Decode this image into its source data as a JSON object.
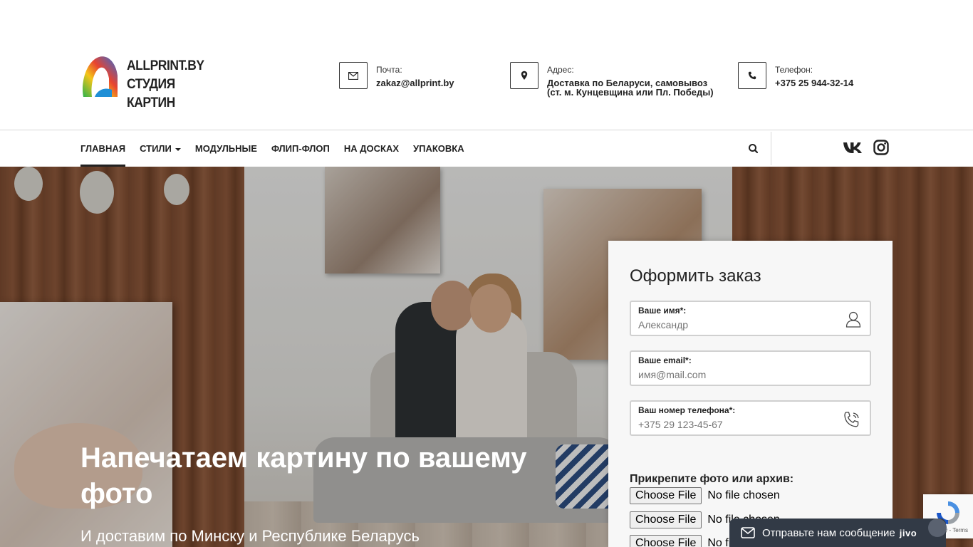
{
  "header": {
    "logo_line1": "ALLPRINT.BY",
    "logo_line2": "СТУДИЯ КАРТИН",
    "contacts": [
      {
        "icon": "envelope-icon",
        "label": "Почта:",
        "value": "zakaz@allprint.by"
      },
      {
        "icon": "map-marker-icon",
        "label": "Адрес:",
        "value_line1": "Доставка по Беларуси, самовывоз",
        "value_line2": "(ст. м. Кунцевщина или Пл. Победы)"
      },
      {
        "icon": "phone-icon",
        "label": "Телефон:",
        "value": "+375 25 944-32-14"
      }
    ]
  },
  "nav": {
    "items": [
      {
        "label": "ГЛАВНАЯ",
        "active": true
      },
      {
        "label": "СТИЛИ",
        "dropdown": true
      },
      {
        "label": "МОДУЛЬНЫЕ"
      },
      {
        "label": "ФЛИП-ФЛОП"
      },
      {
        "label": "НА ДОСКАХ"
      },
      {
        "label": "УПАКОВКА"
      }
    ],
    "social": [
      "vk-icon",
      "instagram-icon"
    ]
  },
  "hero": {
    "title": "Напечатаем картину по вашему фото",
    "subtitle": "И доставим по Минску и Республике Беларусь"
  },
  "order_form": {
    "title": "Оформить заказ",
    "name": {
      "label": "Ваше имя*:",
      "placeholder": "Александр"
    },
    "email": {
      "label": "Ваше email*:",
      "placeholder": "имя@mail.com"
    },
    "phone": {
      "label": "Ваш номер телефона*:",
      "placeholder": "+375 29 123-45-67"
    },
    "attach_label": "Прикрепите фото или архив:",
    "file_button": "Choose File",
    "file_status": "No file chosen"
  },
  "recaptcha": {
    "terms": "Privacy - Terms"
  },
  "chat": {
    "message": "Отправьте нам сообщение",
    "brand": "jivo"
  },
  "colors": {
    "text": "#222222",
    "chat_bg": "#323a46",
    "form_bg": "#f7f7f7"
  }
}
